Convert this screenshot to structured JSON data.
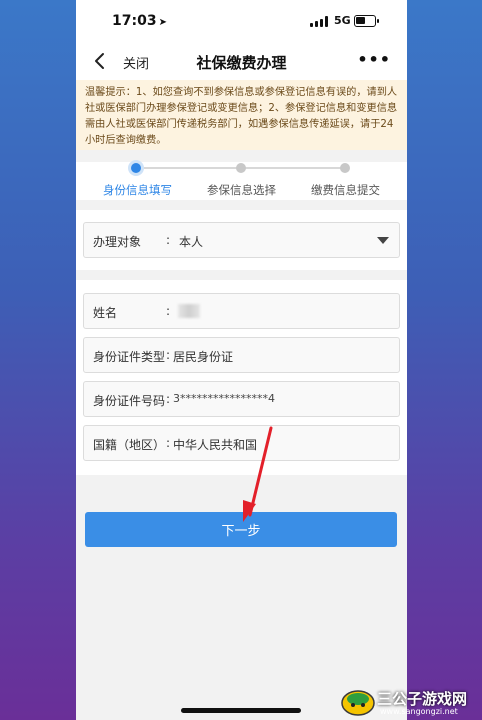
{
  "status_bar": {
    "time": "17:03",
    "network": "5G"
  },
  "nav": {
    "close_label": "关闭",
    "title": "社保缴费办理",
    "more_label": "•••"
  },
  "notice": {
    "text": "温馨提示：1、如您查询不到参保信息或参保登记信息有误的，请到人社或医保部门办理参保登记或变更信息；2、参保登记信息和变更信息需由人社或医保部门传递税务部门，如遇参保信息传递延误，请于24小时后查询缴费。"
  },
  "steps": [
    {
      "label": "身份信息填写",
      "active": true
    },
    {
      "label": "参保信息选择",
      "active": false
    },
    {
      "label": "缴费信息提交",
      "active": false
    }
  ],
  "form": {
    "target": {
      "label": "办理对象",
      "value": "本人"
    },
    "name": {
      "label": "姓名",
      "value": ""
    },
    "id_type": {
      "label": "身份证件类型",
      "value": "居民身份证"
    },
    "id_number": {
      "label": "身份证件号码",
      "value": "3****************4"
    },
    "nationality": {
      "label": "国籍（地区）",
      "value": "中华人民共和国"
    }
  },
  "next_button": {
    "label": "下一步"
  },
  "watermark": {
    "name": "三公子游戏网",
    "url": "www.sangongzi.net"
  },
  "colors": {
    "accent": "#3a8ee6",
    "arrow": "#e3202a",
    "notice_bg": "#fdf3e0"
  }
}
